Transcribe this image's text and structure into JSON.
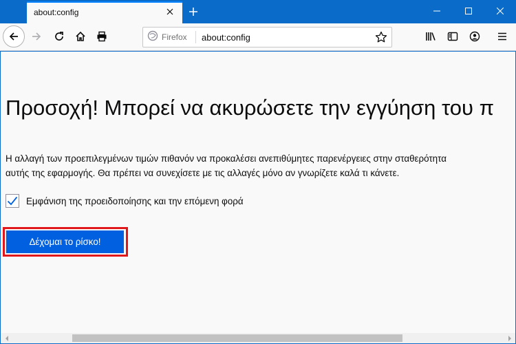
{
  "tab": {
    "title": "about:config"
  },
  "urlbar": {
    "identity_label": "Firefox",
    "url": "about:config"
  },
  "page": {
    "title": "Προσοχή! Μπορεί να ακυρώσετε την εγγύηση του π",
    "warning_line1": "Η αλλαγή των προεπιλεγμένων τιμών πιθανόν να προκαλέσει ανεπιθύμητες παρενέργειες στην σταθερότητα",
    "warning_line2": "αυτής της εφαρμογής. Θα πρέπει να συνεχίσετε με τις αλλαγές μόνο αν γνωρίζετε καλά τι κάνετε.",
    "checkbox_label": "Εμφάνιση της προειδοποίησης και την επόμενη φορά",
    "checkbox_checked": true,
    "accept_button": "Δέχομαι το ρίσκο!"
  },
  "colors": {
    "accent": "#0060df",
    "titlebar": "#0a6cc8",
    "highlight": "#e0181b"
  },
  "icons": [
    "close-icon",
    "plus-icon",
    "minimize-icon",
    "maximize-icon",
    "back-arrow-icon",
    "forward-arrow-icon",
    "reload-icon",
    "home-icon",
    "print-icon",
    "firefox-logo-icon",
    "star-icon",
    "library-icon",
    "sidebar-icon",
    "account-icon",
    "menu-icon"
  ]
}
